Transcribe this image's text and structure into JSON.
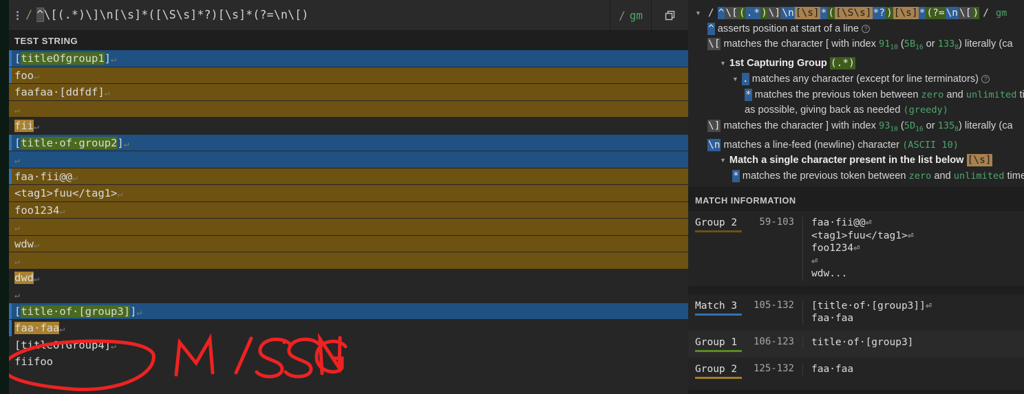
{
  "regex": {
    "pattern": "^\\[(.*)\\]\\n[\\s]*([\\S\\s]*?)[\\s]*(?=\\n\\[)",
    "leading_slash": "/",
    "trailing_slash": "/",
    "flags": "gm",
    "menu_icon": "kebab-menu-icon",
    "copy_icon": "copy-icon"
  },
  "test_string": {
    "label": "TEST STRING",
    "lines": [
      {
        "text": "[titleOfgroup1]",
        "bg": "match",
        "edge": "blue",
        "cr": true,
        "g1": [
          1,
          14
        ]
      },
      {
        "text": "foo",
        "bg": "g2",
        "edge": "blue",
        "cr": true
      },
      {
        "text": "faafaa·[ddfdf]",
        "bg": "g2",
        "edge": "none",
        "cr": true
      },
      {
        "text": "",
        "bg": "g2",
        "edge": "none",
        "cr": true
      },
      {
        "text": "fii",
        "bg": "none",
        "edge": "none",
        "cr": true,
        "g2b": [
          0,
          3
        ]
      },
      {
        "text": "[title·of·group2]",
        "bg": "match",
        "edge": "blue",
        "cr": true,
        "g1": [
          1,
          16
        ]
      },
      {
        "text": "",
        "bg": "match",
        "edge": "none",
        "cr": true
      },
      {
        "text": "faa·fii@@",
        "bg": "g2",
        "edge": "blue",
        "cr": true
      },
      {
        "text": "<tag1>fuu</tag1>",
        "bg": "g2",
        "edge": "none",
        "cr": true
      },
      {
        "text": "foo1234",
        "bg": "g2",
        "edge": "none",
        "cr": true
      },
      {
        "text": "",
        "bg": "g2",
        "edge": "none",
        "cr": true
      },
      {
        "text": "wdw",
        "bg": "g2",
        "edge": "none",
        "cr": true
      },
      {
        "text": "",
        "bg": "g2",
        "edge": "none",
        "cr": true
      },
      {
        "text": "dwd",
        "bg": "none",
        "edge": "none",
        "cr": true,
        "g2b": [
          0,
          3
        ]
      },
      {
        "text": "",
        "bg": "none",
        "edge": "none",
        "cr": true
      },
      {
        "text": "[title·of·[group3]]",
        "bg": "match",
        "edge": "blue",
        "cr": true,
        "g1": [
          1,
          18
        ]
      },
      {
        "text": "faa·faa",
        "bg": "none",
        "edge": "blue",
        "cr": true,
        "g2b": [
          0,
          7
        ]
      },
      {
        "text": "[titleOfGroup4]",
        "bg": "none",
        "edge": "none",
        "cr": true
      },
      {
        "text": "fiifoo",
        "bg": "none",
        "edge": "none",
        "cr": false
      }
    ]
  },
  "annotation": {
    "text": "MISSING",
    "color": "#ee2222",
    "shape": "circle-and-handwriting"
  },
  "explanation": {
    "header_tokens": [
      {
        "t": "/",
        "k": "plain"
      },
      {
        "t": "^",
        "k": "blue"
      },
      {
        "t": "\\[",
        "k": "gray"
      },
      {
        "t": "(",
        "k": "green"
      },
      {
        "t": ".",
        "k": "blue"
      },
      {
        "t": "*",
        "k": "blue"
      },
      {
        "t": ")",
        "k": "green"
      },
      {
        "t": "\\]",
        "k": "gray"
      },
      {
        "t": "\\n",
        "k": "blue"
      },
      {
        "t": "[\\s]",
        "k": "tan"
      },
      {
        "t": "*",
        "k": "blue"
      },
      {
        "t": "(",
        "k": "green"
      },
      {
        "t": "[\\S\\s]",
        "k": "tan"
      },
      {
        "t": "*?",
        "k": "blue"
      },
      {
        "t": ")",
        "k": "green"
      },
      {
        "t": "[\\s]",
        "k": "tan"
      },
      {
        "t": "*",
        "k": "blue"
      },
      {
        "t": "(?=",
        "k": "green"
      },
      {
        "t": "\\n",
        "k": "blue"
      },
      {
        "t": "\\[",
        "k": "gray"
      },
      {
        "t": ")",
        "k": "green"
      },
      {
        "t": "/",
        "k": "plain"
      },
      {
        "t": "gm",
        "k": "flags"
      }
    ],
    "rows": [
      {
        "indent": 1,
        "tri": false,
        "token": "^",
        "tk": "blue",
        "text": " asserts position at start of a line",
        "help": true
      },
      {
        "indent": 1,
        "tri": false,
        "token": "\\[",
        "tk": "gray",
        "text": " matches the character [ with index ",
        "idx_dec": "91",
        "idx_hex": "5B",
        "idx_oct": "133",
        "tail": ") literally (ca"
      },
      {
        "indent": 2,
        "tri": true,
        "bold_text": "1st Capturing Group",
        "token2": "(.*)",
        "tk2": "green"
      },
      {
        "indent": 3,
        "tri": true,
        "token": ".",
        "tk": "blue",
        "text": " matches any character (except for line terminators)",
        "help": true
      },
      {
        "indent": 4,
        "tri": false,
        "token": "*",
        "tk": "blue",
        "text": " matches the previous token between ",
        "g1": "zero",
        "mid": " and ",
        "g2": "unlimited",
        "tail2": " tim"
      },
      {
        "indent": 4,
        "tri": false,
        "plain": "as possible, giving back as needed ",
        "mono_tail": "(greedy)"
      },
      {
        "indent": 1,
        "tri": false,
        "token": "\\]",
        "tk": "gray",
        "text": " matches the character ] with index ",
        "idx_dec": "93",
        "idx_hex": "5D",
        "idx_oct": "135",
        "tail": ") literally (ca"
      },
      {
        "indent": 1,
        "tri": false,
        "token": "\\n",
        "tk": "blue",
        "text": " matches a line-feed (newline) character ",
        "mono_tail": "(ASCII 10)"
      },
      {
        "indent": 2,
        "tri": true,
        "bold_text": "Match a single character present in the list below",
        "token2": "[\\s]",
        "tk2": "tan"
      },
      {
        "indent": 3,
        "tri": false,
        "token": "*",
        "tk": "blue",
        "text": " matches the previous token between ",
        "g1": "zero",
        "mid": " and ",
        "g2": "unlimited",
        "tail2": " times"
      }
    ]
  },
  "match_information": {
    "header": "MATCH INFORMATION",
    "rows": [
      {
        "label": "Group 2",
        "underline": "brown",
        "range": "59-103",
        "value": "faa·fii@@⏎\n<tag1>fuu</tag1>⏎\nfoo1234⏎\n⏎\nwdw...",
        "alt": false
      },
      {
        "label": "Match 3",
        "underline": "blue",
        "range": "105-132",
        "value": "[title·of·[group3]]⏎\nfaa·faa",
        "alt": false
      },
      {
        "label": "Group 1",
        "underline": "green",
        "range": "106-123",
        "value": "title·of·[group3]",
        "alt": true
      },
      {
        "label": "Group 2",
        "underline": "gold",
        "range": "125-132",
        "value": "faa·faa",
        "alt": false
      }
    ]
  }
}
